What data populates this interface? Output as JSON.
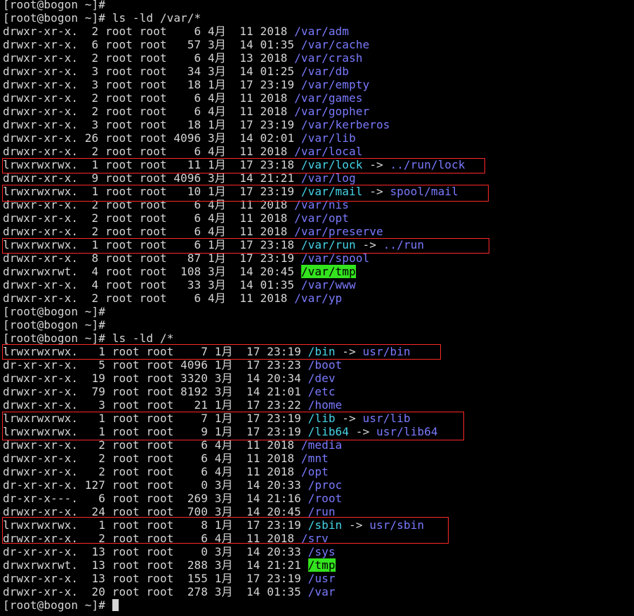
{
  "terminal": {
    "lines": [
      {
        "segments": [
          {
            "text": "[root@bogon ~]#",
            "type": "text"
          }
        ]
      },
      {
        "segments": [
          {
            "text": "[root@bogon ~]# ls -ld /var/*",
            "type": "text"
          }
        ]
      },
      {
        "segments": [
          {
            "text": "drwxr-xr-x.  2 root root    6 4月  11 2018 ",
            "type": "text"
          },
          {
            "text": "/var/adm",
            "type": "dir"
          }
        ]
      },
      {
        "segments": [
          {
            "text": "drwxr-xr-x.  6 root root   57 3月  14 01:35 ",
            "type": "text"
          },
          {
            "text": "/var/cache",
            "type": "dir"
          }
        ]
      },
      {
        "segments": [
          {
            "text": "drwxr-xr-x.  2 root root    6 4月  13 2018 ",
            "type": "text"
          },
          {
            "text": "/var/crash",
            "type": "dir"
          }
        ]
      },
      {
        "segments": [
          {
            "text": "drwxr-xr-x.  3 root root   34 3月  14 01:25 ",
            "type": "text"
          },
          {
            "text": "/var/db",
            "type": "dir"
          }
        ]
      },
      {
        "segments": [
          {
            "text": "drwxr-xr-x.  3 root root   18 1月  17 23:19 ",
            "type": "text"
          },
          {
            "text": "/var/empty",
            "type": "dir"
          }
        ]
      },
      {
        "segments": [
          {
            "text": "drwxr-xr-x.  2 root root    6 4月  11 2018 ",
            "type": "text"
          },
          {
            "text": "/var/games",
            "type": "dir"
          }
        ]
      },
      {
        "segments": [
          {
            "text": "drwxr-xr-x.  2 root root    6 4月  11 2018 ",
            "type": "text"
          },
          {
            "text": "/var/gopher",
            "type": "dir"
          }
        ]
      },
      {
        "segments": [
          {
            "text": "drwxr-xr-x.  3 root root   18 1月  17 23:19 ",
            "type": "text"
          },
          {
            "text": "/var/kerberos",
            "type": "dir"
          }
        ]
      },
      {
        "segments": [
          {
            "text": "drwxr-xr-x. 26 root root 4096 3月  14 02:01 ",
            "type": "text"
          },
          {
            "text": "/var/lib",
            "type": "dir"
          }
        ]
      },
      {
        "segments": [
          {
            "text": "drwxr-xr-x.  2 root root    6 4月  11 2018 ",
            "type": "text"
          },
          {
            "text": "/var/local",
            "type": "dir"
          }
        ]
      },
      {
        "segments": [
          {
            "text": "lrwxrwxrwx.  1 root root   11 1月  17 23:18 ",
            "type": "text"
          },
          {
            "text": "/var/lock",
            "type": "link"
          },
          {
            "text": " -> ",
            "type": "text"
          },
          {
            "text": "../run/lock",
            "type": "target"
          }
        ]
      },
      {
        "segments": [
          {
            "text": "drwxr-xr-x.  9 root root 4096 3月  14 21:21 ",
            "type": "text"
          },
          {
            "text": "/var/log",
            "type": "dir"
          }
        ]
      },
      {
        "segments": [
          {
            "text": "lrwxrwxrwx.  1 root root   10 1月  17 23:19 ",
            "type": "text"
          },
          {
            "text": "/var/mail",
            "type": "link"
          },
          {
            "text": " -> ",
            "type": "text"
          },
          {
            "text": "spool/mail",
            "type": "target"
          }
        ]
      },
      {
        "segments": [
          {
            "text": "drwxr-xr-x.  2 root root    6 4月  11 2018 ",
            "type": "text"
          },
          {
            "text": "/var/nis",
            "type": "dir"
          }
        ]
      },
      {
        "segments": [
          {
            "text": "drwxr-xr-x.  2 root root    6 4月  11 2018 ",
            "type": "text"
          },
          {
            "text": "/var/opt",
            "type": "dir"
          }
        ]
      },
      {
        "segments": [
          {
            "text": "drwxr-xr-x.  2 root root    6 4月  11 2018 ",
            "type": "text"
          },
          {
            "text": "/var/preserve",
            "type": "dir"
          }
        ]
      },
      {
        "segments": [
          {
            "text": "lrwxrwxrwx.  1 root root    6 1月  17 23:18 ",
            "type": "text"
          },
          {
            "text": "/var/run",
            "type": "link"
          },
          {
            "text": " -> ",
            "type": "text"
          },
          {
            "text": "../run",
            "type": "target"
          }
        ]
      },
      {
        "segments": [
          {
            "text": "drwxr-xr-x.  8 root root   87 1月  17 23:19 ",
            "type": "text"
          },
          {
            "text": "/var/spool",
            "type": "dir"
          }
        ]
      },
      {
        "segments": [
          {
            "text": "drwxrwxrwt.  4 root root  108 3月  14 20:45 ",
            "type": "text"
          },
          {
            "text": "/var/tmp",
            "type": "sticky"
          }
        ]
      },
      {
        "segments": [
          {
            "text": "drwxr-xr-x.  4 root root   33 3月  14 01:35 ",
            "type": "text"
          },
          {
            "text": "/var/www",
            "type": "dir"
          }
        ]
      },
      {
        "segments": [
          {
            "text": "drwxr-xr-x.  2 root root    6 4月  11 2018 ",
            "type": "text"
          },
          {
            "text": "/var/yp",
            "type": "dir"
          }
        ]
      },
      {
        "segments": [
          {
            "text": "[root@bogon ~]#",
            "type": "text"
          }
        ]
      },
      {
        "segments": [
          {
            "text": "[root@bogon ~]#",
            "type": "text"
          }
        ]
      },
      {
        "segments": [
          {
            "text": "[root@bogon ~]# ls -ld /*",
            "type": "text"
          }
        ]
      },
      {
        "segments": [
          {
            "text": "lrwxrwxrwx.   1 root root    7 1月  17 23:19 ",
            "type": "text"
          },
          {
            "text": "/bin",
            "type": "link"
          },
          {
            "text": " -> ",
            "type": "text"
          },
          {
            "text": "usr/bin",
            "type": "target"
          }
        ]
      },
      {
        "segments": [
          {
            "text": "dr-xr-xr-x.   5 root root 4096 1月  17 23:23 ",
            "type": "text"
          },
          {
            "text": "/boot",
            "type": "dir"
          }
        ]
      },
      {
        "segments": [
          {
            "text": "drwxr-xr-x.  19 root root 3320 3月  14 20:34 ",
            "type": "text"
          },
          {
            "text": "/dev",
            "type": "dir"
          }
        ]
      },
      {
        "segments": [
          {
            "text": "drwxr-xr-x.  79 root root 8192 3月  14 21:01 ",
            "type": "text"
          },
          {
            "text": "/etc",
            "type": "dir"
          }
        ]
      },
      {
        "segments": [
          {
            "text": "drwxr-xr-x.   3 root root   21 1月  17 23:22 ",
            "type": "text"
          },
          {
            "text": "/home",
            "type": "dir"
          }
        ]
      },
      {
        "segments": [
          {
            "text": "lrwxrwxrwx.   1 root root    7 1月  17 23:19 ",
            "type": "text"
          },
          {
            "text": "/lib",
            "type": "link"
          },
          {
            "text": " -> ",
            "type": "text"
          },
          {
            "text": "usr/lib",
            "type": "target"
          }
        ]
      },
      {
        "segments": [
          {
            "text": "lrwxrwxrwx.   1 root root    9 1月  17 23:19 ",
            "type": "text"
          },
          {
            "text": "/lib64",
            "type": "link"
          },
          {
            "text": " -> ",
            "type": "text"
          },
          {
            "text": "usr/lib64",
            "type": "target"
          }
        ]
      },
      {
        "segments": [
          {
            "text": "drwxr-xr-x.   2 root root    6 4月  11 2018 ",
            "type": "text"
          },
          {
            "text": "/media",
            "type": "dir"
          }
        ]
      },
      {
        "segments": [
          {
            "text": "drwxr-xr-x.   2 root root    6 4月  11 2018 ",
            "type": "text"
          },
          {
            "text": "/mnt",
            "type": "dir"
          }
        ]
      },
      {
        "segments": [
          {
            "text": "drwxr-xr-x.   2 root root    6 4月  11 2018 ",
            "type": "text"
          },
          {
            "text": "/opt",
            "type": "dir"
          }
        ]
      },
      {
        "segments": [
          {
            "text": "dr-xr-xr-x. 127 root root    0 3月  14 20:33 ",
            "type": "text"
          },
          {
            "text": "/proc",
            "type": "dir"
          }
        ]
      },
      {
        "segments": [
          {
            "text": "dr-xr-x---.   6 root root  269 3月  14 21:16 ",
            "type": "text"
          },
          {
            "text": "/root",
            "type": "dir"
          }
        ]
      },
      {
        "segments": [
          {
            "text": "drwxr-xr-x.  24 root root  700 3月  14 20:45 ",
            "type": "text"
          },
          {
            "text": "/run",
            "type": "dir"
          }
        ]
      },
      {
        "segments": [
          {
            "text": "lrwxrwxrwx.   1 root root    8 1月  17 23:19 ",
            "type": "text"
          },
          {
            "text": "/sbin",
            "type": "link"
          },
          {
            "text": " -> ",
            "type": "text"
          },
          {
            "text": "usr/sbin",
            "type": "target"
          }
        ]
      },
      {
        "segments": [
          {
            "text": "drwxr-xr-x.   2 root root    6 4月  11 2018 ",
            "type": "text"
          },
          {
            "text": "/srv",
            "type": "dir"
          }
        ]
      },
      {
        "segments": [
          {
            "text": "dr-xr-xr-x.  13 root root    0 3月  14 20:33 ",
            "type": "text"
          },
          {
            "text": "/sys",
            "type": "dir"
          }
        ]
      },
      {
        "segments": [
          {
            "text": "drwxrwxrwt.  13 root root  288 3月  14 21:21 ",
            "type": "text"
          },
          {
            "text": "/tmp",
            "type": "sticky"
          }
        ]
      },
      {
        "segments": [
          {
            "text": "drwxr-xr-x.  13 root root  155 1月  17 23:19 ",
            "type": "text"
          },
          {
            "text": "/usr",
            "type": "dir"
          }
        ]
      },
      {
        "segments": [
          {
            "text": "drwxr-xr-x.  20 root root  278 3月  14 01:35 ",
            "type": "text"
          },
          {
            "text": "/var",
            "type": "dir"
          }
        ]
      },
      {
        "segments": [
          {
            "text": "[root@bogon ~]# ",
            "type": "text"
          }
        ],
        "cursor": true
      }
    ]
  },
  "colors": {
    "background": "#000000",
    "text": "#d6d6d6",
    "directory": "#7a7aff",
    "symlink": "#46d4e8",
    "link_target": "#7a7aff",
    "sticky_bg": "#33e31e",
    "highlight_box": "#ff2828"
  }
}
